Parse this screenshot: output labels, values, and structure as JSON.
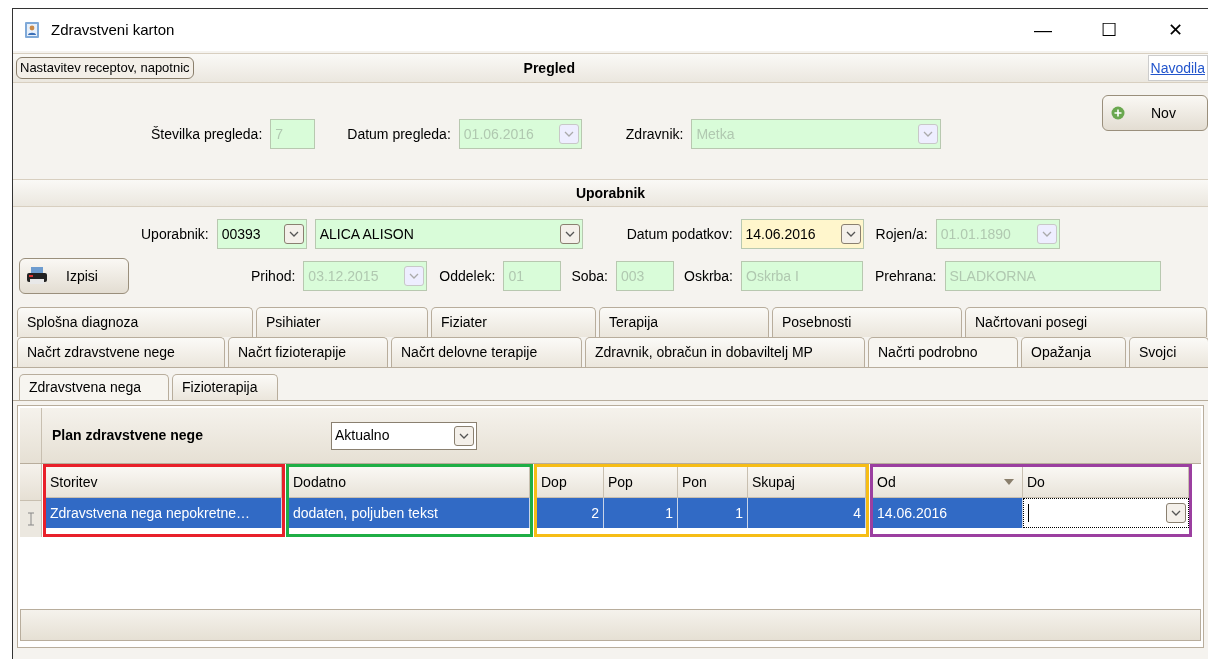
{
  "window": {
    "title": "Zdravstveni karton",
    "controls": [
      "—",
      "☐",
      "✕"
    ]
  },
  "pregled": {
    "header": "Pregled",
    "left_button": "Nastavitev receptov, napotnic",
    "link": "Navodila",
    "new_button": "Nov",
    "fields": [
      {
        "label": "Številka pregleda:",
        "value": "7",
        "kind": "text",
        "disabled": true,
        "focused": false
      },
      {
        "label": "Datum pregleda:",
        "value": "01.06.2016",
        "kind": "combo",
        "disabled": true,
        "focused": false
      },
      {
        "label": "Zdravnik:",
        "value": "Metka",
        "kind": "combo",
        "disabled": true,
        "focused": false
      }
    ]
  },
  "uporabnik": {
    "header": "Uporabnik",
    "print_button": "Izpisi",
    "row1": [
      {
        "label": "Uporabnik:",
        "value": "00393",
        "kind": "combo",
        "disabled": false,
        "focused": false
      },
      {
        "value": "ALICA ALISON",
        "kind": "combo",
        "disabled": false,
        "focused": false
      },
      {
        "label": "Datum podatkov:",
        "value": "14.06.2016",
        "kind": "combo",
        "disabled": false,
        "focused": true
      },
      {
        "label": "Rojen/a:",
        "value": "01.01.1890",
        "kind": "combo",
        "disabled": true,
        "focused": false
      }
    ],
    "row2": [
      {
        "label": "Prihod:",
        "value": "03.12.2015",
        "kind": "combo",
        "disabled": true,
        "focused": false
      },
      {
        "label": "Oddelek:",
        "value": "01",
        "kind": "text",
        "disabled": true,
        "focused": false
      },
      {
        "label": "Soba:",
        "value": "003",
        "kind": "text",
        "disabled": true,
        "focused": false
      },
      {
        "label": "Oskrba:",
        "value": "Oskrba I",
        "kind": "text",
        "disabled": true,
        "focused": false
      },
      {
        "label": "Prehrana:",
        "value": "SLADKORNA",
        "kind": "text",
        "disabled": true,
        "focused": false
      }
    ]
  },
  "tabs_row1": [
    {
      "label": "Splošna diagnoza",
      "selected": false
    },
    {
      "label": "Psihiater",
      "selected": false
    },
    {
      "label": "Fiziater",
      "selected": false
    },
    {
      "label": "Terapija",
      "selected": false
    },
    {
      "label": "Posebnosti",
      "selected": false
    },
    {
      "label": "Načrtovani posegi",
      "selected": false
    }
  ],
  "tabs_row2": [
    {
      "label": "Načrt zdravstvene nege",
      "selected": false
    },
    {
      "label": "Načrt fizioterapije",
      "selected": false
    },
    {
      "label": "Načrt delovne terapije",
      "selected": false
    },
    {
      "label": "Zdravnik, obračun in dobaviltelj MP",
      "selected": false
    },
    {
      "label": "Načrti podrobno",
      "selected": true
    },
    {
      "label": "Opažanja",
      "selected": false
    },
    {
      "label": "Svojci",
      "selected": false
    }
  ],
  "sub_tabs": [
    {
      "label": "Zdravstvena nega",
      "selected": true
    },
    {
      "label": "Fizioterapija",
      "selected": false
    }
  ],
  "grid": {
    "title": "Plan zdravstvene nege",
    "filter": "Aktualno",
    "column_groups": [
      {
        "color": "#e8202a",
        "columns": [
          {
            "heading": "Storitev",
            "sorted": false,
            "cell": "Zdravstvena nega nepokretne…",
            "kind": "text"
          }
        ]
      },
      {
        "color": "#1fae45",
        "columns": [
          {
            "heading": "Dodatno",
            "sorted": false,
            "cell": "dodaten, poljuben tekst",
            "kind": "text"
          }
        ]
      },
      {
        "color": "#f6bd16",
        "columns": [
          {
            "heading": "Dop",
            "sorted": false,
            "cell": "2",
            "kind": "number"
          },
          {
            "heading": "Pop",
            "sorted": false,
            "cell": "1",
            "kind": "number"
          },
          {
            "heading": "Pon",
            "sorted": false,
            "cell": "1",
            "kind": "number"
          },
          {
            "heading": "Skupaj",
            "sorted": false,
            "cell": "4",
            "kind": "number"
          }
        ]
      },
      {
        "color": "#9b3fa0",
        "columns": [
          {
            "heading": "Od",
            "sorted": true,
            "cell": "14.06.2016",
            "kind": "text"
          },
          {
            "heading": "Do",
            "sorted": false,
            "kind": "editor"
          }
        ]
      }
    ],
    "row_selected": true
  }
}
